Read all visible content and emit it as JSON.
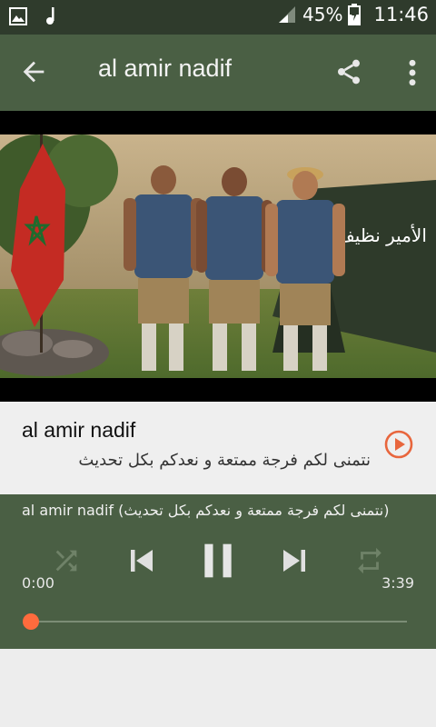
{
  "status_bar": {
    "battery_percent": "45%",
    "time": "11:46",
    "icons": [
      "image-icon",
      "music-note-icon",
      "signal-icon",
      "battery-icon"
    ]
  },
  "app_bar": {
    "title": "al amir nadif",
    "icons": [
      "back-arrow-icon",
      "share-icon",
      "more-vert-icon"
    ]
  },
  "song": {
    "title": "al amir nadif",
    "subtitle": "نتمنى لكم فرجة ممتعة و نعدكم بكل تحديث"
  },
  "player": {
    "now_playing": "al amir nadif (نتمنى لكم فرجة ممتعة و نعدكم بكل تحديث)",
    "time_start": "0:00",
    "time_end": "3:39",
    "progress": 0.0,
    "state": "playing"
  },
  "video": {
    "overlay_text": "الأمير نظيف"
  },
  "colors": {
    "status_bar": "#2f3b2c",
    "app_bar": "#4a5f44",
    "accent": "#ff6b3d"
  }
}
